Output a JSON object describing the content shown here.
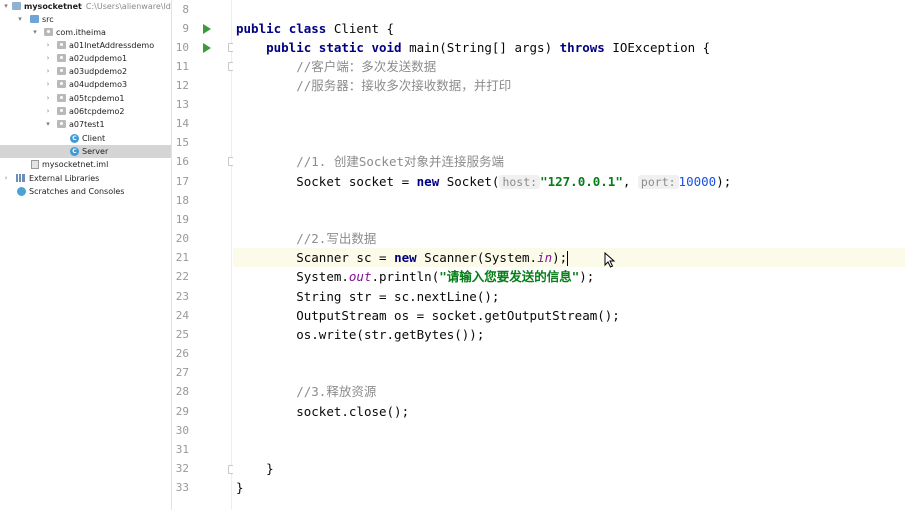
{
  "project_tree": {
    "root": {
      "name": "mysocketnet",
      "path": "C:\\Users\\alienware\\Ide"
    },
    "src": "src",
    "package": "com.itheima",
    "subpackages": [
      "a01InetAddressdemo",
      "a02udpdemo1",
      "a03udpdemo2",
      "a04udpdemo3",
      "a05tcpdemo1",
      "a06tcpdemo2",
      "a07test1"
    ],
    "classes": [
      "Client",
      "Server"
    ],
    "selected_class": "Server",
    "module_file": "mysocketnet.iml",
    "external_libraries": "External Libraries",
    "scratches": "Scratches and Consoles"
  },
  "editor": {
    "current_line_number": 21,
    "line_numbers": [
      "8",
      "9",
      "10",
      "11",
      "12",
      "13",
      "14",
      "15",
      "16",
      "17",
      "18",
      "19",
      "20",
      "21",
      "22",
      "23",
      "24",
      "25",
      "26",
      "27",
      "28",
      "29",
      "30",
      "31",
      "32",
      "33"
    ],
    "code": {
      "l9_kw1": "public",
      "l9_kw2": "class",
      "l9_name": "Client {",
      "l10_kw1": "public",
      "l10_kw2": "static",
      "l10_kw3": "void",
      "l10_sig": "main(String[] args)",
      "l10_kw4": "throws",
      "l10_rest": "IOException {",
      "l11_comment": "//客户端：多次发送数据",
      "l12_comment": "//服务器：接收多次接收数据，并打印",
      "l16_comment": "//1. 创建Socket对象并连接服务端",
      "l17_a": "Socket socket = ",
      "l17_new": "new",
      "l17_b": " Socket(",
      "l17_hint_host": "host:",
      "l17_host": "\"127.0.0.1\"",
      "l17_comma": ",",
      "l17_hint_port": "port:",
      "l17_port": "10000",
      "l17_end": ");",
      "l20_comment": "//2.写出数据",
      "l21_a": "Scanner sc = ",
      "l21_new": "new",
      "l21_b": " Scanner(System.",
      "l21_in": "in",
      "l21_end": ");",
      "l22_a": "System.",
      "l22_out": "out",
      "l22_b": ".println(",
      "l22_str": "\"请输入您要发送的信息\"",
      "l22_end": ");",
      "l23": "String str = sc.nextLine();",
      "l24": "OutputStream os = socket.getOutputStream();",
      "l25": "os.write(str.getBytes());",
      "l28_comment": "//3.释放资源",
      "l29": "socket.close();",
      "l32": "}",
      "l33": "}"
    }
  },
  "colors": {
    "keyword": "#000080",
    "comment": "#8c8c8c",
    "string": "#067d17",
    "number": "#1750eb",
    "static_field": "#871094",
    "run_icon": "#3c9a3c",
    "current_line": "#fcfae8",
    "selection": "#d5d5d5"
  },
  "icons": [
    "run-icon",
    "fold-icon",
    "folder-icon",
    "package-icon",
    "class-icon",
    "module-file-icon",
    "libraries-icon",
    "scratches-icon",
    "chevron-right-icon",
    "chevron-down-icon"
  ]
}
